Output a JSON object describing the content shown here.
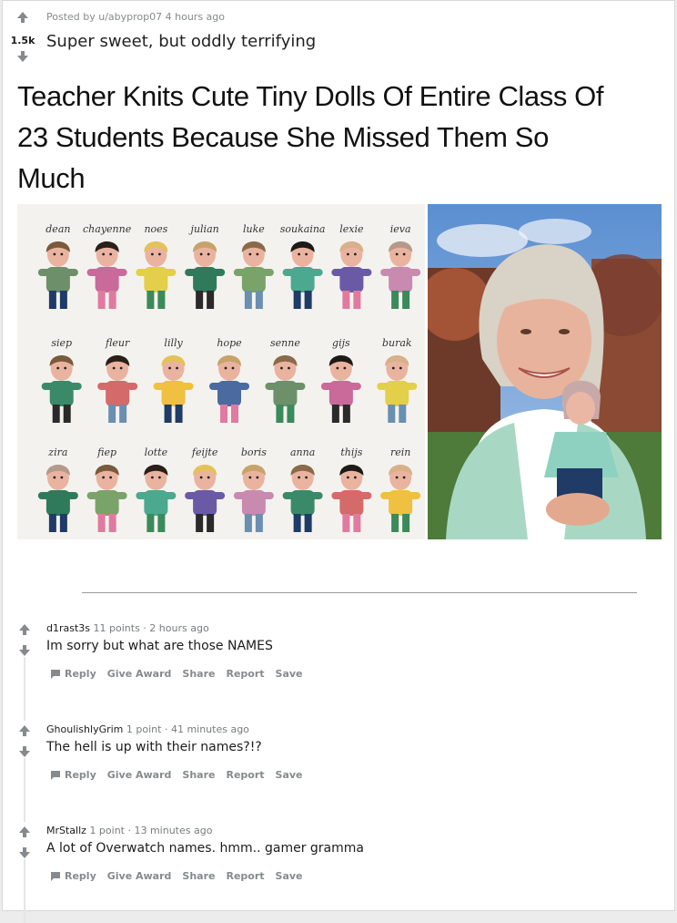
{
  "post": {
    "meta": "Posted by u/abyprop07 4 hours ago",
    "score": "1.5k",
    "title": "Super sweet, but oddly terrifying",
    "headline": "Teacher Knits Cute Tiny Dolls Of Entire Class Of 23 Students Because She Missed Them So Much"
  },
  "dolls": {
    "row1": [
      "dean",
      "chayenne",
      "noes",
      "julian",
      "luke",
      "soukaina",
      "lexie",
      "ieva"
    ],
    "row2": [
      "siep",
      "fleur",
      "lilly",
      "hope",
      "senne",
      "gijs",
      "burak"
    ],
    "row3": [
      "zira",
      "fiep",
      "lotte",
      "feijte",
      "boris",
      "anna",
      "thijs",
      "rein"
    ]
  },
  "comments": [
    {
      "user": "d1rast3s",
      "meta": "11 points · 2 hours ago",
      "body": "Im sorry but what are those NAMES"
    },
    {
      "user": "GhoulishlyGrim",
      "meta": "1 point · 41 minutes ago",
      "body": "The hell is up with their names?!?"
    },
    {
      "user": "MrStallz",
      "meta": "1 point · 13 minutes ago",
      "body": "A lot of Overwatch names. hmm.. gamer gramma"
    }
  ],
  "actions": {
    "reply": "Reply",
    "award": "Give Award",
    "share": "Share",
    "report": "Report",
    "save": "Save"
  },
  "colors": {
    "arrow": "#878a8c",
    "text": "#1c1c1c",
    "meta": "#787c7e"
  }
}
